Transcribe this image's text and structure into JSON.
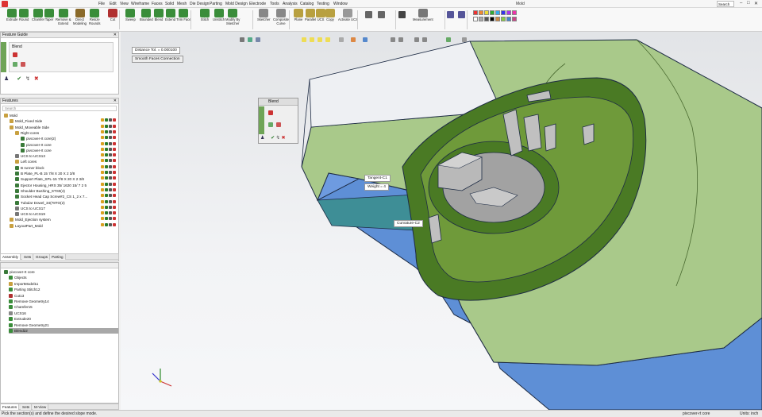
{
  "app": {
    "title": "Mold",
    "search_placeholder": "Search"
  },
  "menu": [
    "File",
    "Edit",
    "View",
    "Wireframe",
    "Faces",
    "Solid",
    "Mesh",
    "Die Design",
    "Parting",
    "Mold Design",
    "Electrode",
    "Tools",
    "Analysis",
    "Catalog",
    "Testing",
    "Window"
  ],
  "ribbon": {
    "buttons": [
      {
        "label": "Extrude",
        "color": "#3a8d3a"
      },
      {
        "label": "Round",
        "color": "#3a8d3a"
      },
      {
        "label": "Chamfer",
        "color": "#3a8d3a"
      },
      {
        "label": "Taper",
        "color": "#3a8d3a"
      },
      {
        "label": "Remove &\nExtend",
        "color": "#3a8d3a"
      },
      {
        "label": "Direct\nModeling",
        "color": "#8a6a2a"
      },
      {
        "label": "Resize\nRounds",
        "color": "#3a8d3a"
      },
      {
        "label": "Cut",
        "color": "#b03030"
      },
      {
        "label": "Sweep",
        "color": "#3a8d3a"
      },
      {
        "label": "Bounded",
        "color": "#3a8d3a"
      },
      {
        "label": "Blend",
        "color": "#3a8d3a"
      },
      {
        "label": "Extend",
        "color": "#3a8d3a"
      },
      {
        "label": "Trim Face",
        "color": "#3a8d3a"
      },
      {
        "label": "Stitch",
        "color": "#3a8d3a"
      },
      {
        "label": "Unstitch",
        "color": "#3a8d3a"
      },
      {
        "label": "Modify By\nSketcher",
        "color": "#3a8d3a"
      },
      {
        "label": "Sketcher",
        "color": "#888888"
      },
      {
        "label": "Composite\nCurve",
        "color": "#888888"
      },
      {
        "label": "Plane",
        "color": "#b8a040"
      },
      {
        "label": "Parallel",
        "color": "#b8a040"
      },
      {
        "label": "UCS",
        "color": "#b8a040"
      },
      {
        "label": "Copy",
        "color": "#b8a040"
      },
      {
        "label": "Activate UCS",
        "color": "#999999"
      },
      {
        "label": "Measurement",
        "color": "#777777"
      }
    ]
  },
  "feature_guide": {
    "title": "Feature Guide",
    "item": "Blend"
  },
  "features": {
    "title": "Features",
    "search_placeholder": "Search",
    "items": [
      {
        "label": "Mold",
        "indent": 0,
        "color": "#c8a040"
      },
      {
        "label": "Mold_Fixed Side",
        "indent": 1,
        "color": "#c8a040"
      },
      {
        "label": "Mold_Moveable Side",
        "indent": 1,
        "color": "#c8a040"
      },
      {
        "label": "Right cores",
        "indent": 2,
        "color": "#c8a040"
      },
      {
        "label": "pivcover-rt core(2)",
        "indent": 3,
        "color": "#3a7a3a"
      },
      {
        "label": "pivcover-rt core",
        "indent": 3,
        "color": "#3a7a3a"
      },
      {
        "label": "pivcover-rt core",
        "indent": 3,
        "color": "#3a7a3a"
      },
      {
        "label": "UCS to UCS13",
        "indent": 2,
        "color": "#777777"
      },
      {
        "label": "Left cores",
        "indent": 2,
        "color": "#c8a040"
      },
      {
        "label": "B runner block",
        "indent": 2,
        "color": "#3a7a3a"
      },
      {
        "label": "B Plate_PL-B 15 7/8 X 20 X 2 3/8",
        "indent": 2,
        "color": "#3a7a3a"
      },
      {
        "label": "Support Plate_SPL-15 7/8 X 20 X 2 3/8",
        "indent": 2,
        "color": "#3a7a3a"
      },
      {
        "label": "Ejector Housing_HRS 35/ 1620 15/ 7 2 5",
        "indent": 2,
        "color": "#3a7a3a"
      },
      {
        "label": "Shoulder Bushing_STS0(4)",
        "indent": 2,
        "color": "#3a7a3a"
      },
      {
        "label": "Socket Head Cap Screw#2_CS 1_2 x 7...",
        "indent": 2,
        "color": "#3a7a3a"
      },
      {
        "label": "Tubular Dowel_34(78TO(2)",
        "indent": 2,
        "color": "#3a7a3a"
      },
      {
        "label": "UCS to UCS17",
        "indent": 2,
        "color": "#777777"
      },
      {
        "label": "UCS to UCS19",
        "indent": 2,
        "color": "#777777"
      },
      {
        "label": "Mold_Ejection system",
        "indent": 1,
        "color": "#c8a040"
      },
      {
        "label": "LayoutPart_Mold",
        "indent": 1,
        "color": "#c8a040"
      }
    ],
    "tabs": [
      "Assembly",
      "Sets",
      "Groups",
      "Parting"
    ]
  },
  "history": {
    "root": "pivcover-rt core",
    "items": [
      "Objects",
      "ImportModel11",
      "Parting Stitch12",
      "Cut13",
      "Remove Geometry14",
      "Chamfer15",
      "UCS16",
      "Extrude20",
      "Remove Geometry21",
      "Blend22"
    ],
    "selected": "Blend22",
    "tabs": [
      "Features",
      "Sets",
      "M-View"
    ]
  },
  "viewport": {
    "distance_tol": "Distance Tol. = 0.000100",
    "smooth_faces": "Smooth Faces Connection",
    "blend_panel_title": "Blend",
    "tag_tangent": "Tangent-C1",
    "tag_weight": "Weight = 4",
    "tag_curvature": "Curvature-C2"
  },
  "status": {
    "hint": "Pick the section(s) and define the desired slope mode.",
    "part": "pivcover-rt core",
    "units": "Units: inch"
  },
  "colors": {
    "green_face": "#a9c98a",
    "dark_green": "#4a7a24",
    "blue_face": "#5e8fd6",
    "teal_face": "#3e8e96",
    "gray_part": "#b5b5b5"
  }
}
